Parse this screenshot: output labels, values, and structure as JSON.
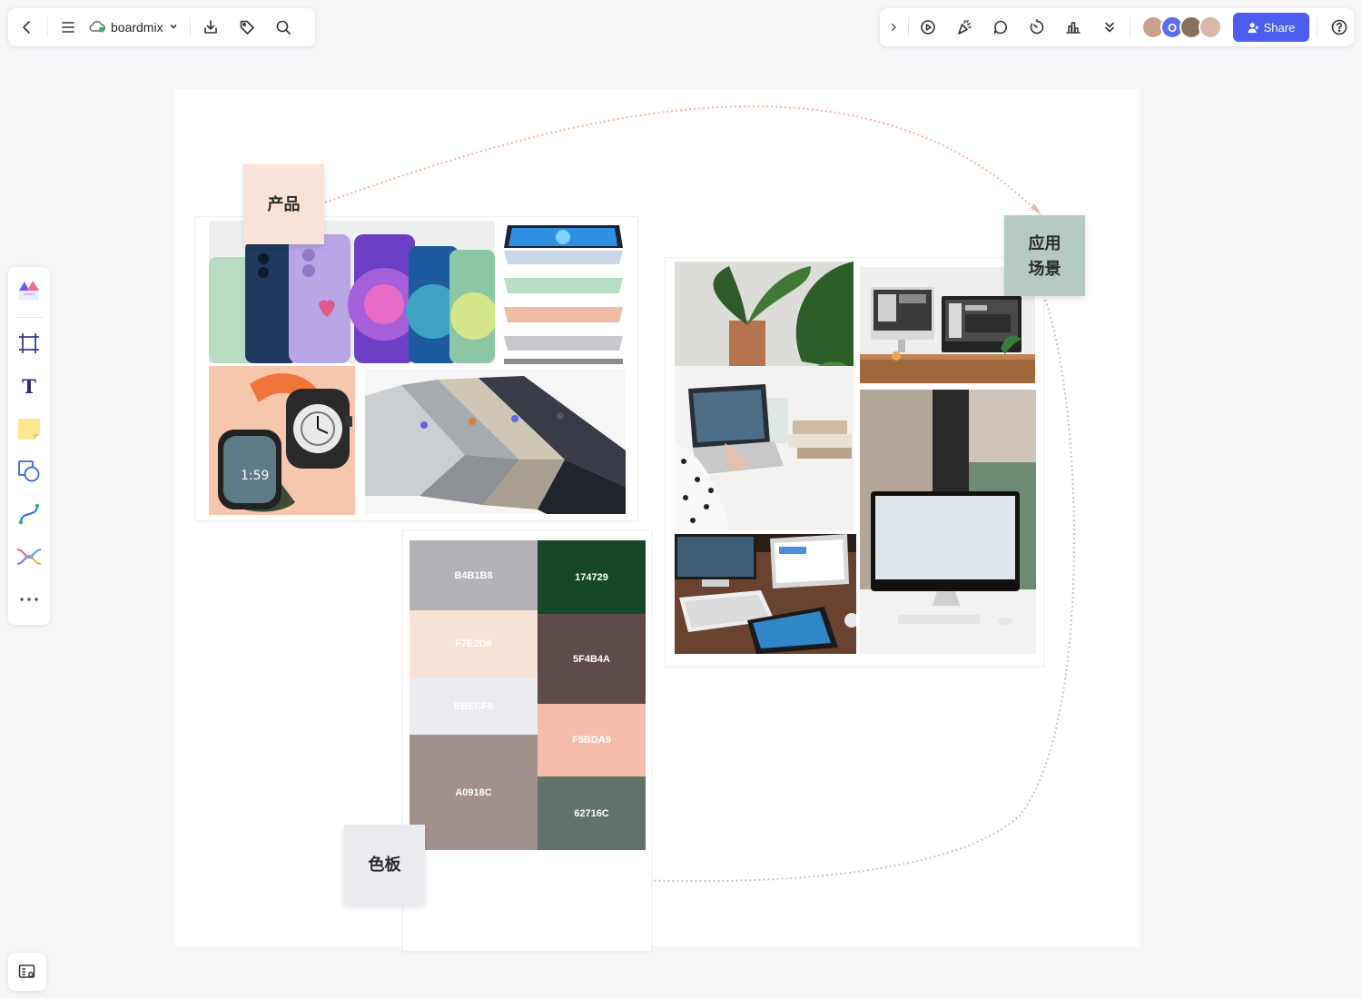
{
  "app": {
    "doc_name": "boardmix",
    "share_label": "Share"
  },
  "collaborators": [
    {
      "initial": "",
      "color": "#c9a08a"
    },
    {
      "initial": "O",
      "color": "#5b6cf0"
    },
    {
      "initial": "",
      "color": "#8a6e5e"
    },
    {
      "initial": "",
      "color": "#d8b8a8"
    }
  ],
  "stickies": {
    "product": "产品",
    "scene_line1": "应用",
    "scene_line2": "场景",
    "palette": "色板"
  },
  "palette": {
    "left": [
      {
        "hex": "B4B1B8",
        "color": "#B4B1B8"
      },
      {
        "hex": "F7E2D6",
        "color": "#F7E2D6"
      },
      {
        "hex": "EBECF0",
        "color": "#EBECF0"
      },
      {
        "hex": "A0918C",
        "color": "#A0918C"
      }
    ],
    "right": [
      {
        "hex": "174729",
        "color": "#174729"
      },
      {
        "hex": "5F4B4A",
        "color": "#5F4B4A"
      },
      {
        "hex": "F5BDA9",
        "color": "#F5BDA9"
      },
      {
        "hex": "62716C",
        "color": "#62716C"
      }
    ]
  },
  "colors": {
    "accent": "#4b5cf0",
    "product_sticky": "#f9e3d8",
    "scene_sticky": "#b5cbc1",
    "palette_sticky": "#ebecf0"
  }
}
